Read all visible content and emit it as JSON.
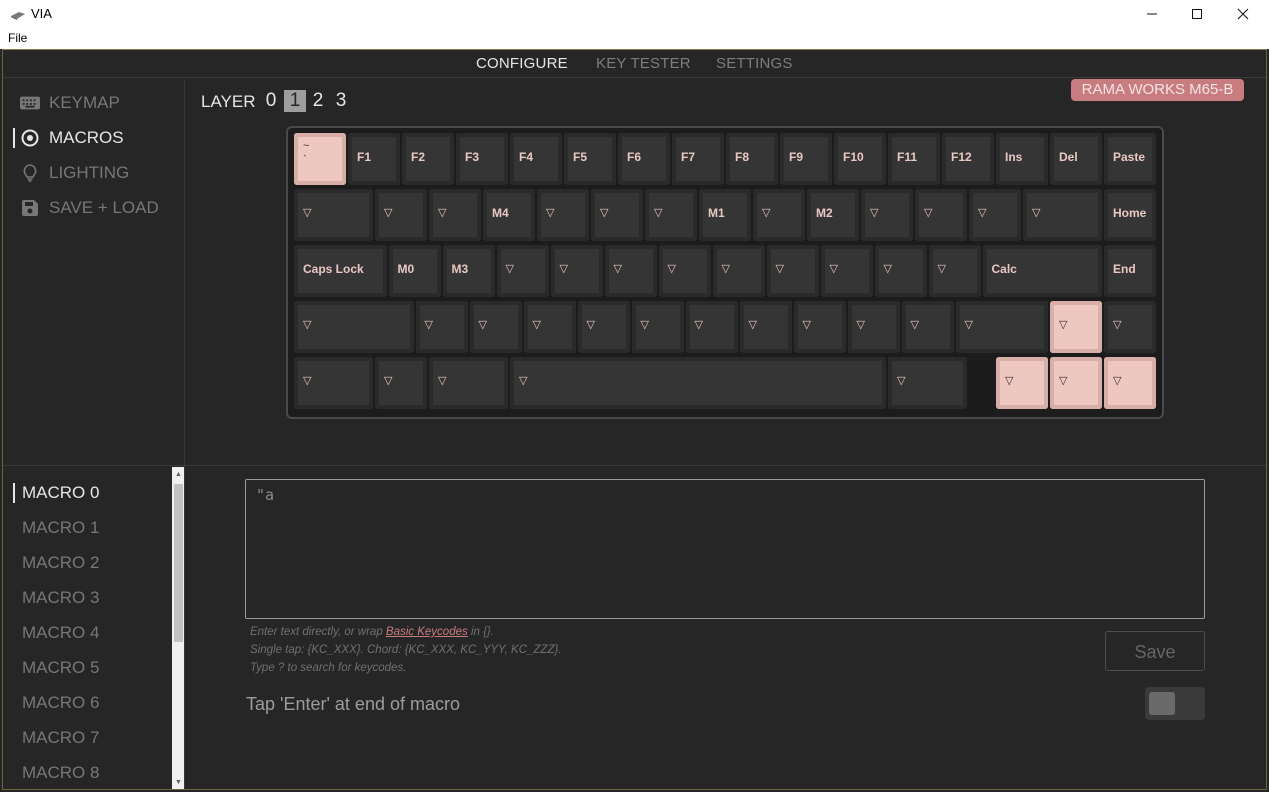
{
  "window": {
    "title": "VIA",
    "menu": [
      "File"
    ]
  },
  "nav": {
    "tabs": [
      "CONFIGURE",
      "KEY TESTER",
      "SETTINGS"
    ],
    "active": "CONFIGURE"
  },
  "sidebar": {
    "items": [
      {
        "label": "KEYMAP",
        "icon": "keyboard-icon"
      },
      {
        "label": "MACROS",
        "icon": "target-icon",
        "active": true
      },
      {
        "label": "LIGHTING",
        "icon": "lightbulb-icon"
      },
      {
        "label": "SAVE + LOAD",
        "icon": "floppy-disk-icon"
      }
    ]
  },
  "layers": {
    "label": "LAYER",
    "numbers": [
      "0",
      "1",
      "2",
      "3"
    ],
    "active": "1"
  },
  "keyboard_name": "RAMA WORKS M65-B",
  "keyboard": {
    "rows": [
      [
        "~\n`",
        "F1",
        "F2",
        "F3",
        "F4",
        "F5",
        "F6",
        "F7",
        "F8",
        "F9",
        "F10",
        "F11",
        "F12",
        "Ins",
        "Del",
        "Paste"
      ],
      [
        "▽",
        "▽",
        "▽",
        "M4",
        "▽",
        "▽",
        "▽",
        "M1",
        "▽",
        "M2",
        "▽",
        "▽",
        "▽",
        "▽",
        "Home"
      ],
      [
        "Caps Lock",
        "M0",
        "M3",
        "▽",
        "▽",
        "▽",
        "▽",
        "▽",
        "▽",
        "▽",
        "▽",
        "▽",
        "Calc",
        "End"
      ],
      [
        "▽",
        "▽",
        "▽",
        "▽",
        "▽",
        "▽",
        "▽",
        "▽",
        "▽",
        "▽",
        "▽",
        "▽",
        "▽",
        "▽"
      ],
      [
        "▽",
        "▽",
        "▽",
        "▽",
        "▽",
        "▽",
        "▽",
        "▽"
      ]
    ]
  },
  "macros": {
    "items": [
      "MACRO 0",
      "MACRO 1",
      "MACRO 2",
      "MACRO 3",
      "MACRO 4",
      "MACRO 5",
      "MACRO 6",
      "MACRO 7",
      "MACRO 8"
    ],
    "active": "MACRO 0"
  },
  "editor": {
    "value": "\"a",
    "hint_line1_pre": "Enter text directly, or wrap ",
    "hint_link": "Basic Keycodes",
    "hint_line1_post": " in {}.",
    "hint_line2": "Single tap: {KC_XXX}. Chord: {KC_XXX, KC_YYY, KC_ZZZ}.",
    "hint_line3": "Type ? to search for keycodes.",
    "save_label": "Save",
    "enter_toggle_label": "Tap 'Enter' at end of macro",
    "enter_toggle_on": false
  },
  "colors": {
    "accent": "#c87c7f",
    "key_selected": "#efc7c1",
    "key_legend": "#e8c8c3",
    "background": "#262626"
  }
}
